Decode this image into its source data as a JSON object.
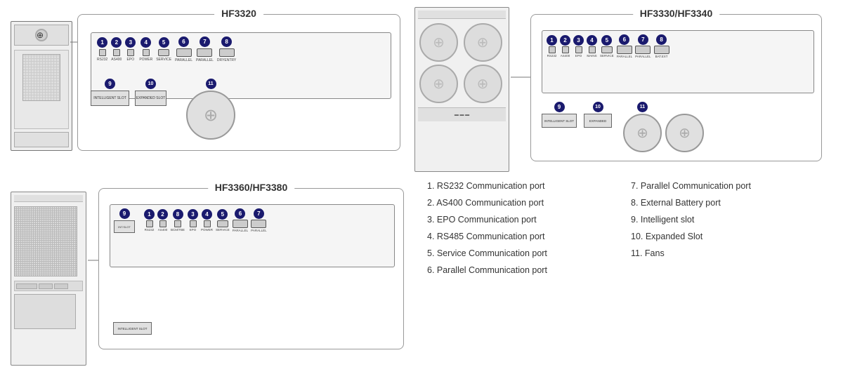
{
  "models": {
    "hf3320": {
      "title": "HF3320"
    },
    "hf3330": {
      "title": "HF3330/HF3340"
    },
    "hf3360": {
      "title": "HF3360/HF3380"
    }
  },
  "legend": {
    "col1": [
      {
        "num": "1.",
        "text": "RS232 Communication port"
      },
      {
        "num": "2.",
        "text": "AS400 Communication port"
      },
      {
        "num": "3.",
        "text": "EPO Communication port"
      },
      {
        "num": "4.",
        "text": "RS485 Communication port"
      },
      {
        "num": "5.",
        "text": "Service Communication port"
      },
      {
        "num": "6.",
        "text": "Parallel Communication port"
      }
    ],
    "col2": [
      {
        "num": "7.",
        "text": "Parallel Communication port"
      },
      {
        "num": "8.",
        "text": "External Battery port"
      },
      {
        "num": "9.",
        "text": "Intelligent slot"
      },
      {
        "num": "10.",
        "text": "Expanded Slot"
      },
      {
        "num": "11.",
        "text": "Fans"
      }
    ]
  },
  "ports": {
    "labels": [
      "RS232",
      "AS400",
      "EPO",
      "POWER",
      "SERVICE",
      "PARALLEL",
      "PARALLEL",
      "DRYENTRY"
    ]
  }
}
